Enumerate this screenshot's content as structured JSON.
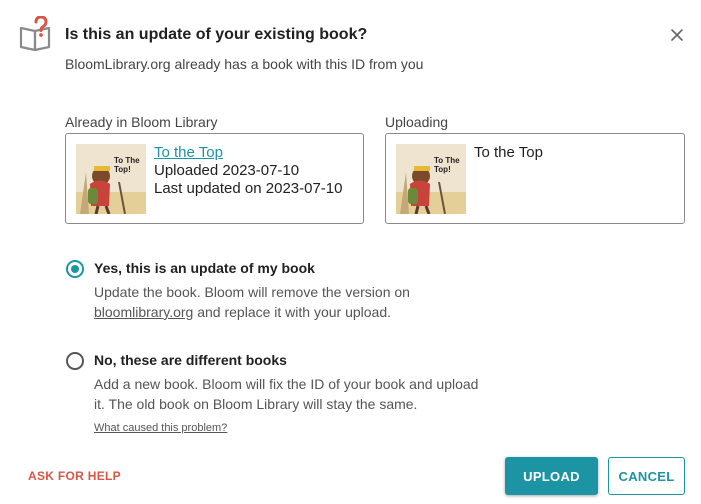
{
  "dialog": {
    "title": "Is this an update of your existing book?",
    "subtitle": "BloomLibrary.org already has a book with this ID from you",
    "close_icon": "close-icon",
    "header_icon": "book-question-icon"
  },
  "existing": {
    "label": "Already in Bloom Library",
    "book_title": "To the Top",
    "uploaded": "Uploaded 2023-07-10",
    "last_updated": "Last updated on 2023-07-10",
    "thumbnail_text": "To The Top!"
  },
  "uploading": {
    "label": "Uploading",
    "book_title": "To the Top",
    "thumbnail_text": "To The Top!"
  },
  "options": {
    "update": {
      "title": "Yes, this is an update of my book",
      "desc_part1": "Update the book. Bloom will remove the version on",
      "desc_link": "bloomlibrary.org",
      "desc_part2": " and replace it with your upload.",
      "selected": true
    },
    "different": {
      "title": "No, these are different books",
      "desc": "Add a new book. Bloom will fix the ID of your book and upload it. The old book on Bloom Library will stay the same.",
      "selected": false
    },
    "problem_link": "What caused this problem?"
  },
  "footer": {
    "ask_help": "ASK FOR HELP",
    "upload": "UPLOAD",
    "cancel": "CANCEL"
  },
  "colors": {
    "accent": "#1d94a4",
    "help": "#d65649",
    "icon_question": "#d65649"
  }
}
